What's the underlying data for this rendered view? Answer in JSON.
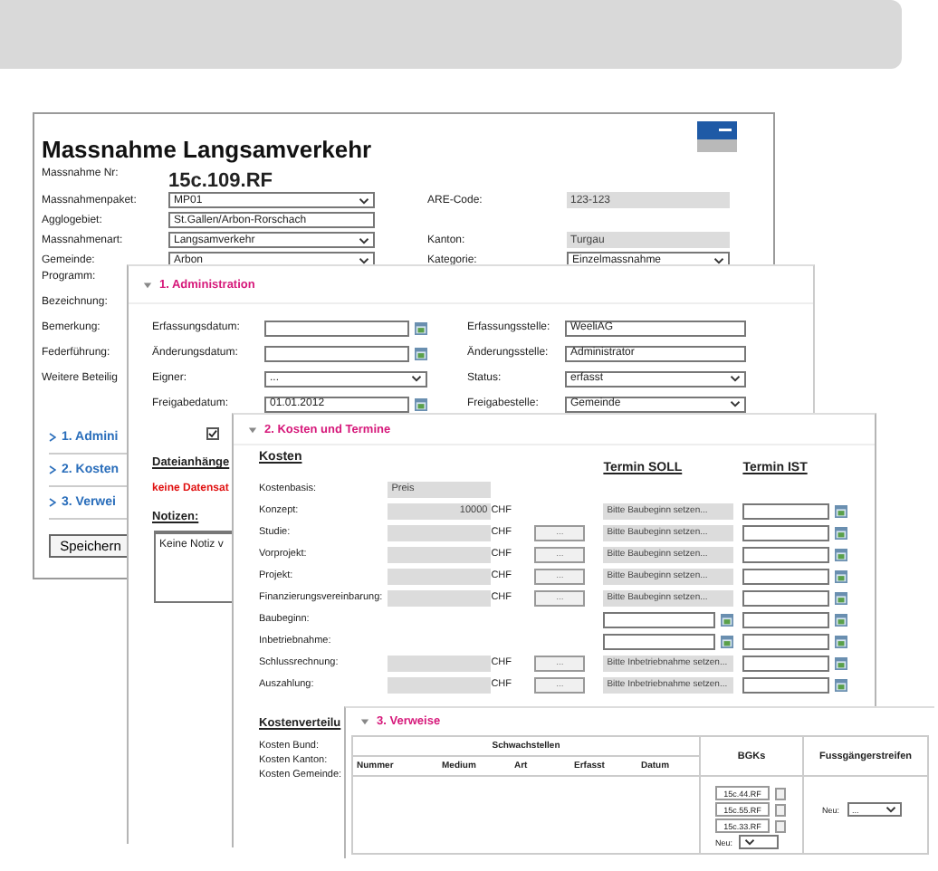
{
  "main": {
    "title": "Massnahme Langsamverkehr",
    "rows": [
      {
        "label": "Massnahme Nr:",
        "kind": "number",
        "value": "15c.109.RF"
      },
      {
        "label": "Massnahmenpaket:",
        "kind": "select",
        "value": "MP01",
        "right": {
          "label": "ARE-Code:",
          "kind": "readonly",
          "value": "123-123"
        }
      },
      {
        "label": "Agglogebiet:",
        "kind": "text",
        "value": "St.Gallen/Arbon-Rorschach"
      },
      {
        "label": "Massnahmenart:",
        "kind": "select",
        "value": "Langsamverkehr",
        "right": {
          "label": "Kanton:",
          "kind": "readonly",
          "value": "Turgau"
        }
      },
      {
        "label": "Gemeinde:",
        "kind": "select",
        "value": "Arbon",
        "right": {
          "label": "Kategorie:",
          "kind": "select",
          "value": "Einzelmassnahme"
        }
      }
    ],
    "more_labels": [
      "Programm:",
      "Bezeichnung:",
      "Bemerkung:",
      "Federführung:",
      "Weitere Beteilig"
    ],
    "nav": [
      "1. Admini",
      "2. Kosten",
      "3. Verwei"
    ],
    "save_button": "Speichern"
  },
  "administration": {
    "title": "1. Administration",
    "expanded": true,
    "rows": [
      {
        "left": {
          "label": "Erfassungsdatum:",
          "kind": "date"
        },
        "right": {
          "label": "Erfassungsstelle:",
          "kind": "text",
          "value": "WeeliAG"
        }
      },
      {
        "left": {
          "label": "Änderungsdatum:",
          "kind": "date"
        },
        "right": {
          "label": "Änderungsstelle:",
          "kind": "text",
          "value": "Administrator"
        }
      },
      {
        "left": {
          "label": "Eigner:",
          "kind": "select",
          "value": "..."
        },
        "right": {
          "label": "Status:",
          "kind": "select",
          "value": "erfasst"
        }
      },
      {
        "left": {
          "label": "Freigabedatum:",
          "kind": "date",
          "value": "01.01.2012"
        },
        "right": {
          "label": "Freigabestelle:",
          "kind": "select",
          "value": "Gemeinde"
        }
      }
    ],
    "checkbox": {
      "checked": true
    },
    "attachments_heading": "Dateianhänge",
    "attachments_empty": "keine Datensat",
    "notes_heading": "Notizen:",
    "notes_text": "Keine Notiz v"
  },
  "costs": {
    "title": "2. Kosten und Termine",
    "expanded": true,
    "heading": "Kosten",
    "soll_heading": "Termin SOLL",
    "ist_heading": "Termin IST",
    "rows": [
      {
        "kind": "basis",
        "label": "Kostenbasis:",
        "value": "Preis"
      },
      {
        "kind": "cost",
        "label": "Konzept:",
        "amount": "10000",
        "currency": "CHF",
        "soll_placeholder": "Bitte Baubeginn setzen..."
      },
      {
        "kind": "cost",
        "label": "Studie:",
        "currency": "CHF",
        "button": "...",
        "soll_placeholder": "Bitte Baubeginn setzen..."
      },
      {
        "kind": "cost",
        "label": "Vorprojekt:",
        "currency": "CHF",
        "button": "...",
        "soll_placeholder": "Bitte Baubeginn setzen..."
      },
      {
        "kind": "cost",
        "label": "Projekt:",
        "currency": "CHF",
        "button": "...",
        "soll_placeholder": "Bitte Baubeginn setzen..."
      },
      {
        "kind": "cost",
        "label": "Finanzierungsvereinbarung:",
        "currency": "CHF",
        "button": "...",
        "soll_placeholder": "Bitte Baubeginn setzen..."
      },
      {
        "kind": "date",
        "label": "Baubeginn:"
      },
      {
        "kind": "date",
        "label": "Inbetriebnahme:"
      },
      {
        "kind": "cost",
        "label": "Schlussrechnung:",
        "currency": "CHF",
        "button": "...",
        "soll_placeholder": "Bitte Inbetriebnahme setzen..."
      },
      {
        "kind": "cost",
        "label": "Auszahlung:",
        "currency": "CHF",
        "button": "...",
        "soll_placeholder": "Bitte Inbetriebnahme setzen..."
      }
    ],
    "distribution_heading": "Kostenverteilu",
    "distribution_labels": [
      "Kosten Bund:",
      "Kosten Kanton:",
      "Kosten Gemeinde:"
    ]
  },
  "references": {
    "title": "3. Verweise",
    "expanded": true,
    "group_heading": "Schwachstellen",
    "columns": [
      "Nummer",
      "Medium",
      "Art",
      "Erfasst",
      "Datum"
    ],
    "bgk_heading": "BGKs",
    "bgks": [
      "15c.44.RF",
      "15c.55.RF",
      "15c.33.RF"
    ],
    "bgk_new_label": "Neu:",
    "crossing_heading": "Fussgängerstreifen",
    "crossing_new_label": "Neu:",
    "crossing_select": "..."
  }
}
